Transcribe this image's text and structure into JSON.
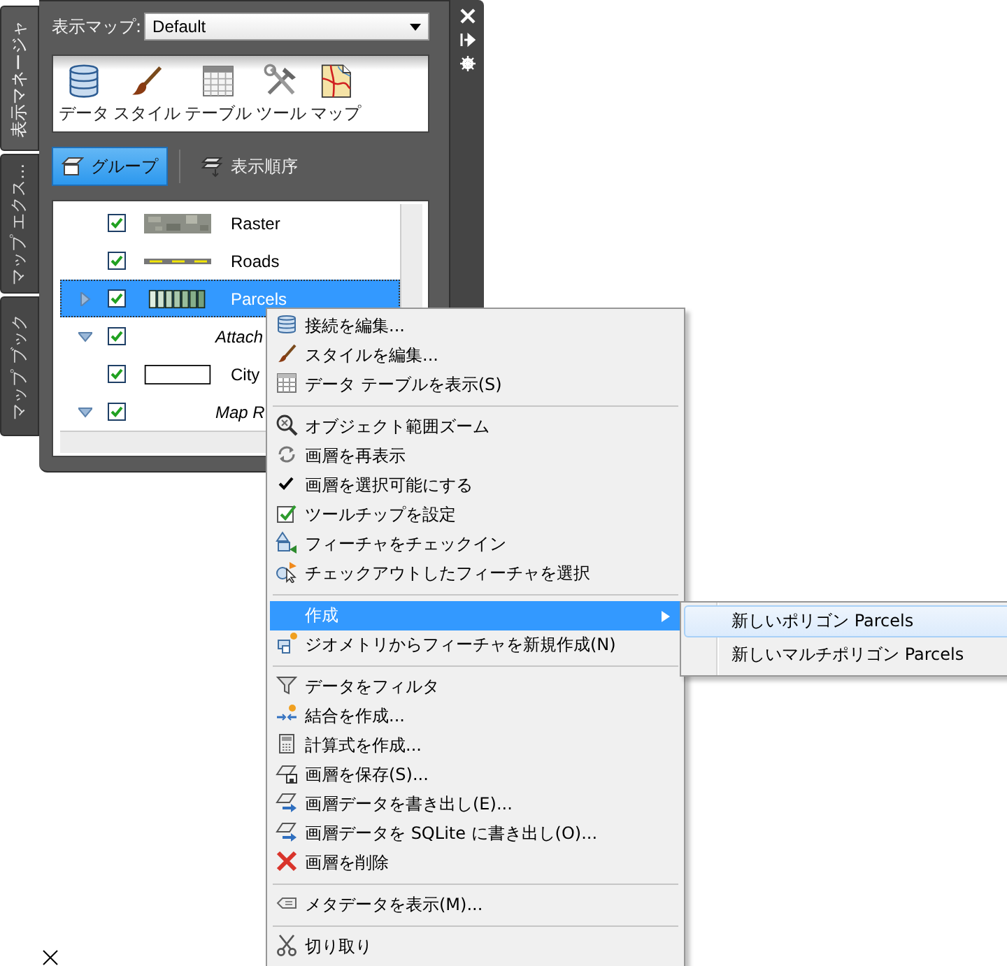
{
  "side_tabs": [
    {
      "label": "表示マネージャ",
      "selected": true
    },
    {
      "label": "マップ エクス...",
      "selected": false
    },
    {
      "label": "マップ ブック",
      "selected": false
    }
  ],
  "map_select": {
    "label": "表示マップ:",
    "value": "Default"
  },
  "toolbar": [
    {
      "label": "データ"
    },
    {
      "label": "スタイル"
    },
    {
      "label": "テーブル"
    },
    {
      "label": "ツール"
    },
    {
      "label": "マップ"
    }
  ],
  "view_buttons": [
    {
      "label": "グループ",
      "selected": true
    },
    {
      "label": "表示順序",
      "selected": false
    }
  ],
  "tree": {
    "items": [
      {
        "label": "Raster",
        "kind": "raster",
        "checked": true,
        "selected": false
      },
      {
        "label": "Roads",
        "kind": "line",
        "checked": true,
        "selected": false
      },
      {
        "label": "Parcels",
        "kind": "polygon",
        "checked": true,
        "selected": true,
        "expanded": false
      },
      {
        "label": "Attach",
        "kind": "group",
        "checked": true,
        "selected": false,
        "expanded": true
      },
      {
        "label": "City",
        "kind": "area",
        "checked": true,
        "selected": false
      },
      {
        "label": "Map R",
        "kind": "group",
        "checked": true,
        "selected": false,
        "expanded": true
      }
    ]
  },
  "menu": {
    "sections": [
      {
        "items": [
          {
            "label": "接続を編集...",
            "checked": false,
            "selected": false
          },
          {
            "label": "スタイルを編集...",
            "checked": false,
            "selected": false
          },
          {
            "label": "データ テーブルを表示(S)",
            "checked": false,
            "selected": false
          }
        ]
      },
      {
        "items": [
          {
            "label": "オブジェクト範囲ズーム",
            "checked": false,
            "selected": false
          },
          {
            "label": "画層を再表示",
            "checked": false,
            "selected": false
          },
          {
            "label": "画層を選択可能にする",
            "checked": true,
            "selected": false
          },
          {
            "label": "ツールチップを設定",
            "checked": false,
            "selected": false
          },
          {
            "label": "フィーチャをチェックイン",
            "checked": false,
            "selected": false
          },
          {
            "label": "チェックアウトしたフィーチャを選択",
            "checked": false,
            "selected": false
          }
        ]
      },
      {
        "items": [
          {
            "label": "作成",
            "checked": false,
            "selected": true,
            "has_submenu": true
          },
          {
            "label": "ジオメトリからフィーチャを新規作成(N)",
            "checked": false,
            "selected": false
          }
        ]
      },
      {
        "items": [
          {
            "label": "データをフィルタ",
            "checked": false,
            "selected": false
          },
          {
            "label": "結合を作成...",
            "checked": false,
            "selected": false
          },
          {
            "label": "計算式を作成...",
            "checked": false,
            "selected": false
          },
          {
            "label": "画層を保存(S)...",
            "checked": false,
            "selected": false
          },
          {
            "label": "画層データを書き出し(E)...",
            "checked": false,
            "selected": false
          },
          {
            "label": "画層データを SQLite に書き出し(O)...",
            "checked": false,
            "selected": false
          },
          {
            "label": "画層を削除",
            "checked": false,
            "selected": false
          }
        ]
      },
      {
        "items": [
          {
            "label": "メタデータを表示(M)...",
            "checked": false,
            "selected": false
          }
        ]
      },
      {
        "items": [
          {
            "label": "切り取り",
            "checked": false,
            "selected": false
          }
        ]
      }
    ]
  },
  "submenu": {
    "items": [
      {
        "label": "新しいポリゴン Parcels",
        "selected": true
      },
      {
        "label": "新しいマルチポリゴン Parcels",
        "selected": false
      }
    ]
  }
}
